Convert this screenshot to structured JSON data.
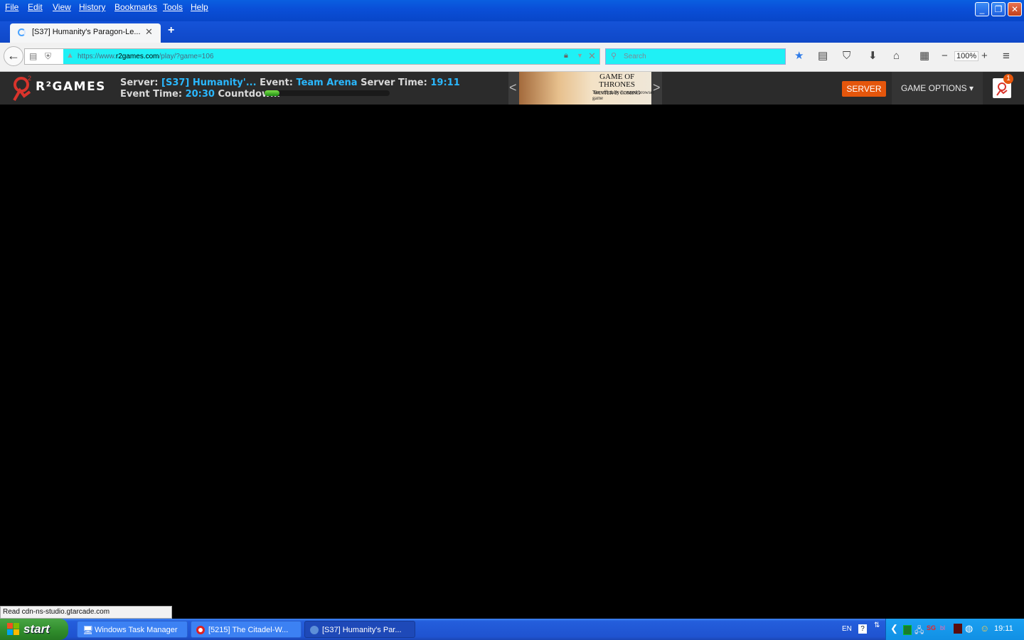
{
  "menubar": {
    "items": [
      "File",
      "Edit",
      "View",
      "History",
      "Bookmarks",
      "Tools",
      "Help"
    ]
  },
  "browser": {
    "tab_title": "[S37] Humanity's Paragon-Le...",
    "url_prefix": "https://www.",
    "url_domain": "r2games.com",
    "url_suffix": "/play/?game=106",
    "search_placeholder": "Search",
    "zoom": "100%",
    "accent_color": "#1ff0f5"
  },
  "game_header": {
    "brand": "R²GAMES",
    "server_label": "Server:",
    "server_value": "[S37] Humanity'...",
    "event_label": "Event:",
    "event_value": "Team Arena",
    "server_time_label": "Server Time:",
    "server_time_value": "19:11",
    "event_time_label": "Event Time:",
    "event_time_value": "20:30",
    "countdown_label": "Countdown:",
    "countdown_fraction": 0.12,
    "banner_title_1": "GAME OF",
    "banner_title_2": "THRONES",
    "banner_tagline": "WINTER IS COMING",
    "banner_sub": "The officially licensed browser game",
    "server_button": "SERVER",
    "game_options": "GAME OPTIONS ▾",
    "notification_count": "1"
  },
  "status_text": "Read cdn-ns-studio.gtarcade.com",
  "taskbar": {
    "start": "start",
    "tasks": [
      "Windows Task Manager",
      "[5215] The Citadel-W...",
      "[S37] Humanity's Par..."
    ],
    "language": "EN",
    "clock": "19:11"
  }
}
